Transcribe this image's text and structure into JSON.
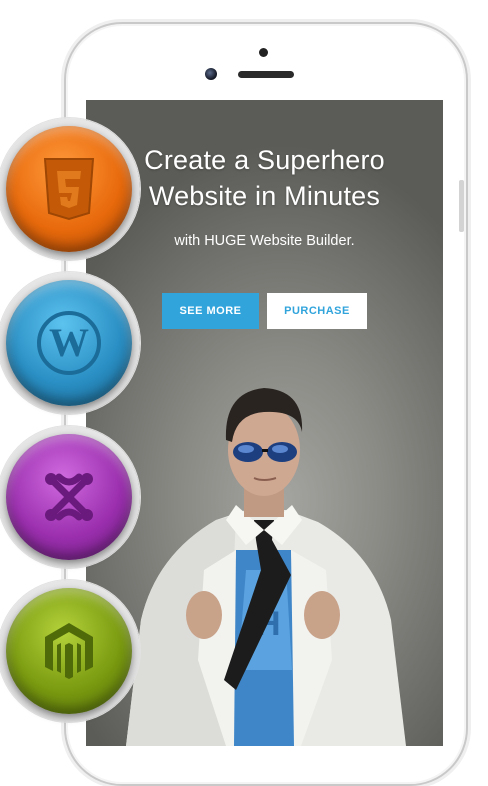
{
  "hero": {
    "title_line1": "Create a Superhero",
    "title_line2": "Website in Minutes",
    "subtitle": "with HUGE Website Builder.",
    "primary_button": "SEE MORE",
    "secondary_button": "PURCHASE"
  },
  "colors": {
    "accent": "#31a4dc",
    "html5_badge": "#e86a0c",
    "wordpress_badge": "#2a8fc4",
    "joomla_badge": "#9b2fae",
    "magento_badge": "#7a9a10"
  },
  "badges": [
    {
      "icon": "html5-icon"
    },
    {
      "icon": "wordpress-icon"
    },
    {
      "icon": "joomla-icon"
    },
    {
      "icon": "magento-icon"
    }
  ]
}
